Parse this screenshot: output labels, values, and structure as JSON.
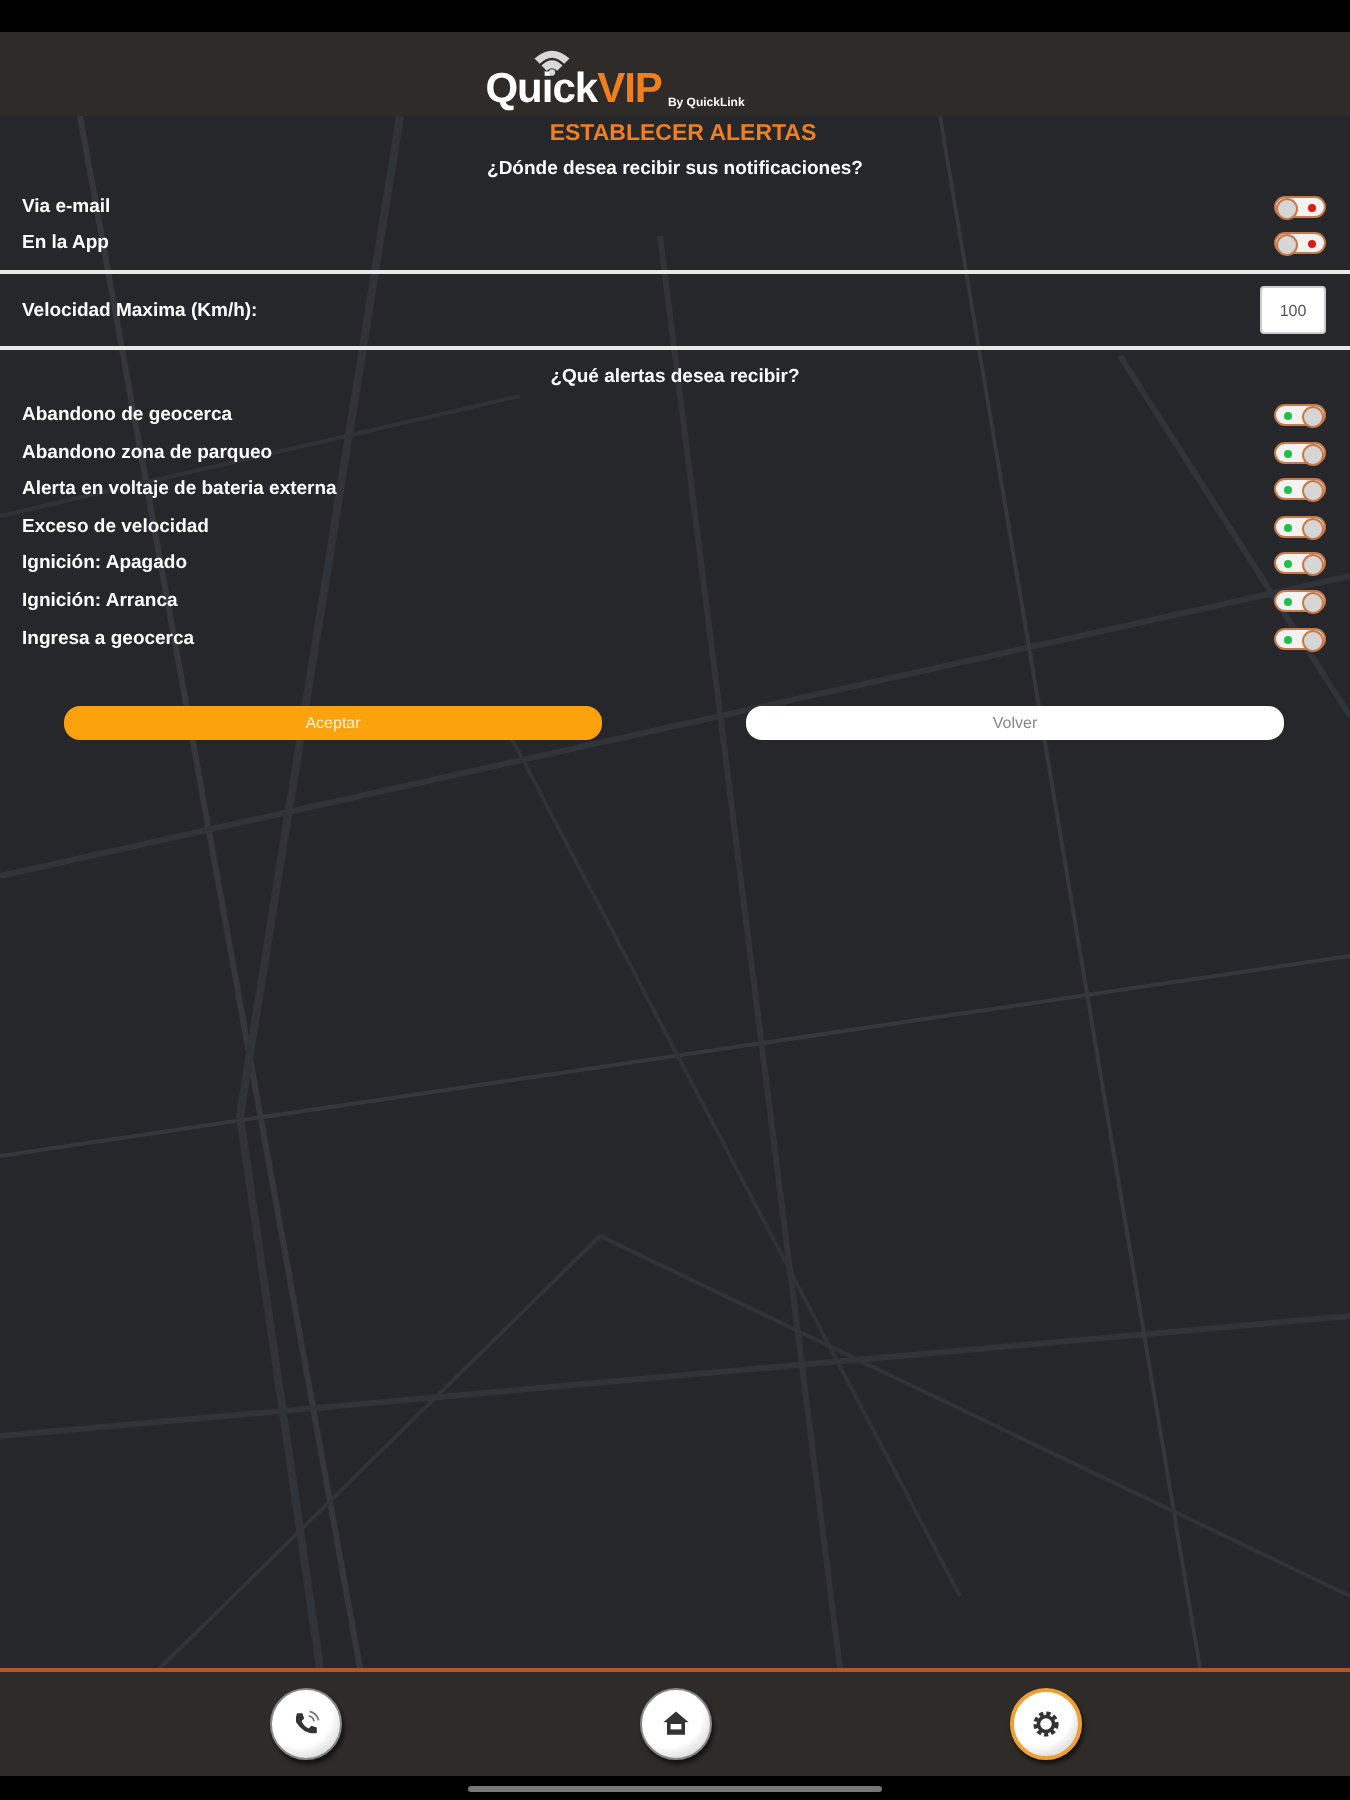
{
  "header": {
    "brand_main": "Quick",
    "brand_accent": "VIP",
    "tagline": "By QuickLink"
  },
  "title": "ESTABLECER ALERTAS",
  "channels_question": "¿Dónde desea recibir sus notificaciones?",
  "channels": [
    {
      "label": "Via e-mail",
      "on": false
    },
    {
      "label": "En la App",
      "on": false
    }
  ],
  "speed": {
    "label": "Velocidad Maxima (Km/h):",
    "value": "100"
  },
  "alerts_question": "¿Qué alertas desea recibir?",
  "alerts": [
    {
      "label": "Abandono de geocerca",
      "on": true
    },
    {
      "label": "Abandono zona de parqueo",
      "on": true
    },
    {
      "label": "Alerta en voltaje de bateria externa",
      "on": true
    },
    {
      "label": "Exceso de velocidad",
      "on": true
    },
    {
      "label": "Ignición: Apagado",
      "on": true
    },
    {
      "label": "Ignición: Arranca",
      "on": true
    },
    {
      "label": "Ingresa a geocerca",
      "on": true
    }
  ],
  "buttons": [
    {
      "label": "Aceptar",
      "kind": "primary"
    },
    {
      "label": "Volver",
      "kind": "secondary"
    }
  ],
  "nav": [
    {
      "kind": "phone",
      "selected": false
    },
    {
      "kind": "home",
      "selected": false
    },
    {
      "kind": "settings",
      "selected": true
    }
  ]
}
